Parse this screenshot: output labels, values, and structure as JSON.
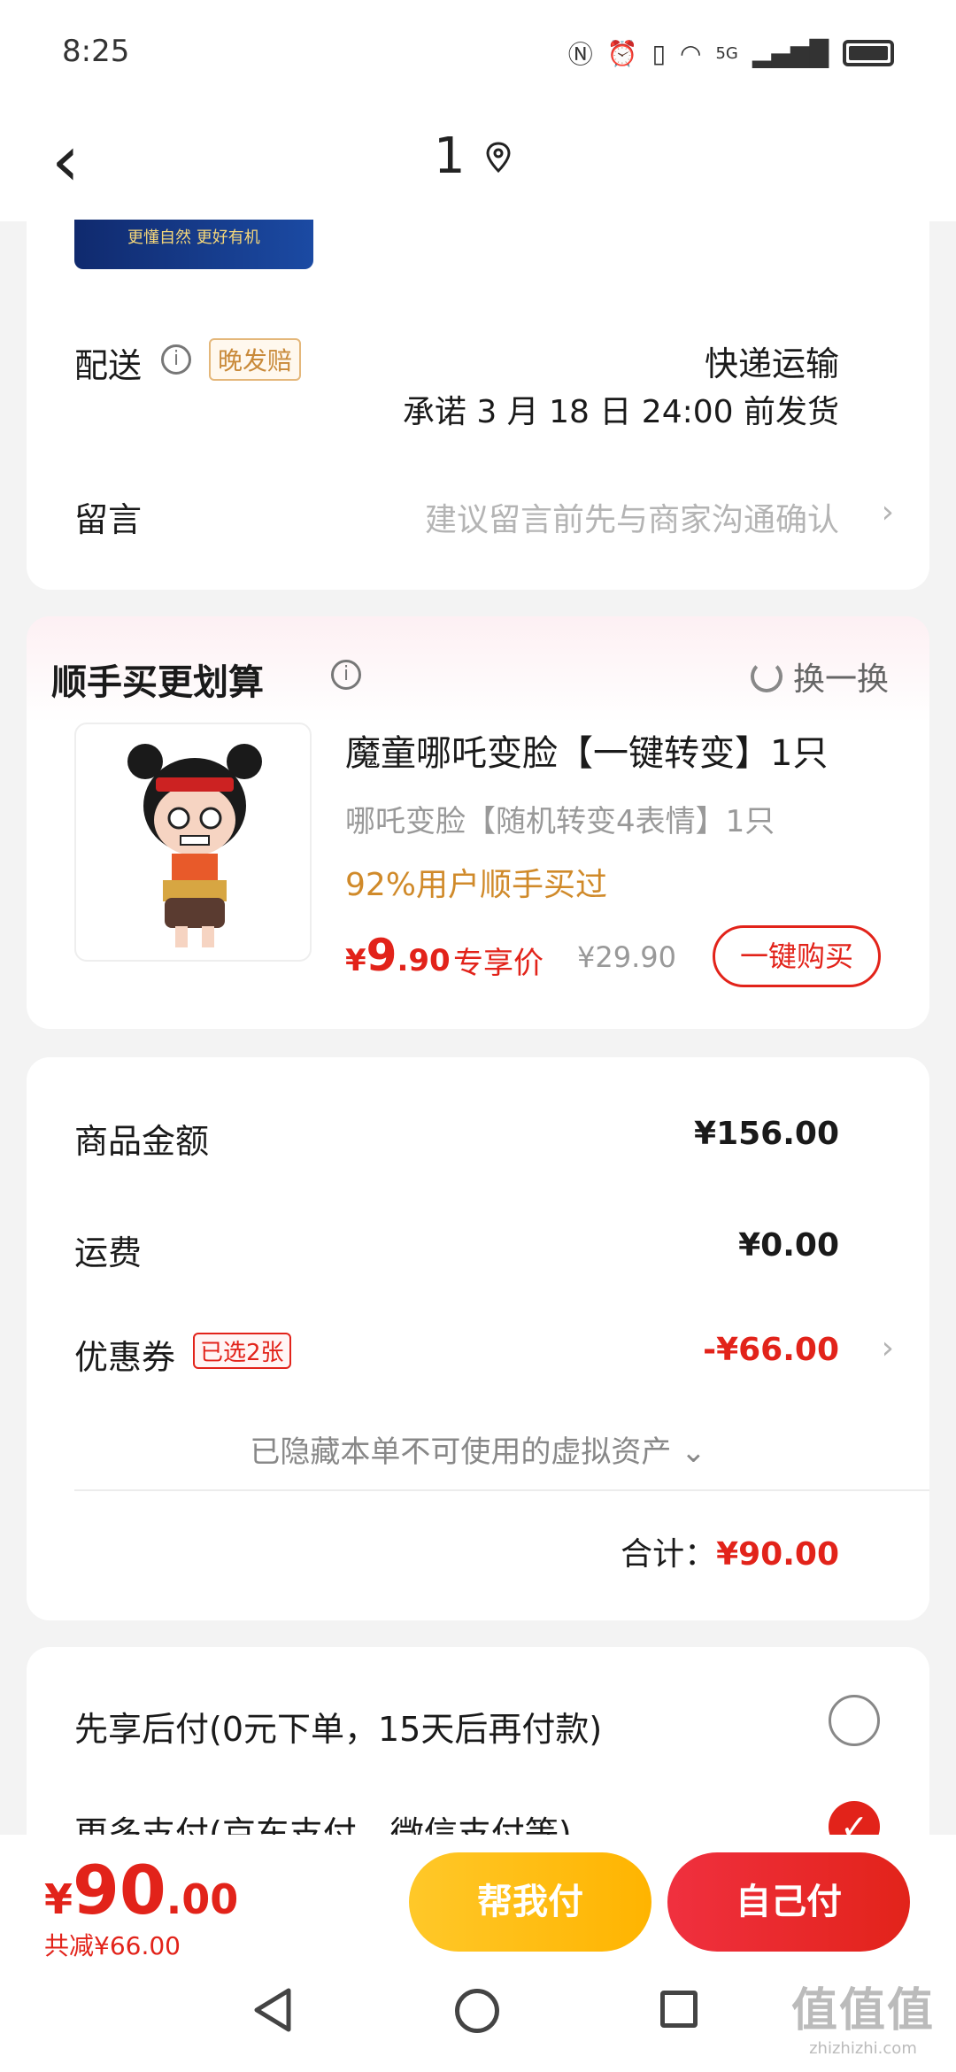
{
  "status": {
    "time": "8:25",
    "network": "5G"
  },
  "nav": {
    "title": "1"
  },
  "banner": {
    "text": "更懂自然 更好有机"
  },
  "delivery": {
    "label": "配送",
    "tag": "晚发赔",
    "method": "快递运输",
    "promise": "承诺 3 月 18 日 24:00 前发货"
  },
  "message": {
    "label": "留言",
    "placeholder": "建议留言前先与商家沟通确认"
  },
  "addon": {
    "title": "顺手买更划算",
    "refresh_label": "换一换",
    "product_name": "魔童哪吒变脸【一键转变】1只",
    "variant": "哪吒变脸【随机转变4表情】1只",
    "popularity": "92%用户顺手买过",
    "price_yen": "¥",
    "price_int": "9",
    "price_dec": ".90",
    "price_tag": "专享价",
    "original_price": "¥29.90",
    "buy_label": "一键购买"
  },
  "summary": {
    "goods_label": "商品金额",
    "goods_value": "¥156.00",
    "shipping_label": "运费",
    "shipping_value": "¥0.00",
    "coupon_label": "优惠券",
    "coupon_tag": "已选2张",
    "coupon_value": "-¥66.00",
    "hidden_note": "已隐藏本单不可使用的虚拟资产",
    "total_label": "合计：",
    "total_value": "¥90.00"
  },
  "payment": {
    "option1": "先享后付(0元下单，15天后再付款)",
    "option2": "更多支付(京东支付、微信支付等)",
    "option1_selected": false,
    "option2_selected": true
  },
  "bottom": {
    "total_yen": "¥",
    "total_int": "90",
    "total_dec": ".00",
    "saved": "共减¥66.00",
    "help_pay": "帮我付",
    "self_pay": "自己付"
  },
  "watermark": {
    "logo": "值值值",
    "site": "zhizhizhi.com"
  },
  "colors": {
    "accent_red": "#e2231a",
    "accent_yellow": "#ffc829",
    "tag_orange": "#c98a3a"
  }
}
